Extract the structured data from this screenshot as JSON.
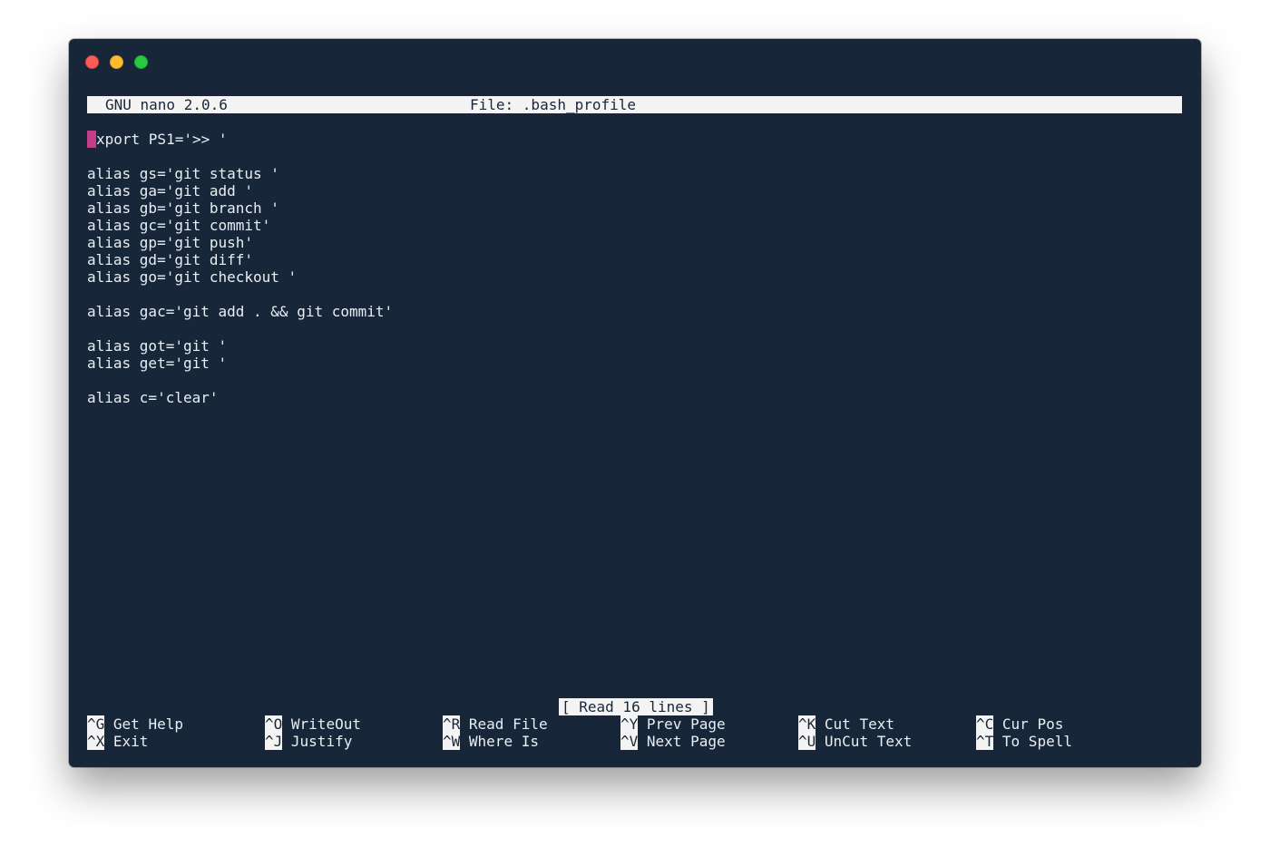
{
  "window": {
    "title_left": "GNU nano 2.0.6",
    "title_right": "File: .bash_profile"
  },
  "editor": {
    "cursor_char": "e",
    "lines": [
      "xport PS1='>> '",
      "",
      "alias gs='git status '",
      "alias ga='git add '",
      "alias gb='git branch '",
      "alias gc='git commit'",
      "alias gp='git push'",
      "alias gd='git diff'",
      "alias go='git checkout '",
      "",
      "alias gac='git add . && git commit'",
      "",
      "alias got='git '",
      "alias get='git '",
      "",
      "alias c='clear'"
    ]
  },
  "status": "[ Read 16 lines ]",
  "shortcuts": {
    "row1": [
      {
        "key": "^G",
        "label": "Get Help"
      },
      {
        "key": "^O",
        "label": "WriteOut"
      },
      {
        "key": "^R",
        "label": "Read File"
      },
      {
        "key": "^Y",
        "label": "Prev Page"
      },
      {
        "key": "^K",
        "label": "Cut Text"
      },
      {
        "key": "^C",
        "label": "Cur Pos"
      }
    ],
    "row2": [
      {
        "key": "^X",
        "label": "Exit"
      },
      {
        "key": "^J",
        "label": "Justify"
      },
      {
        "key": "^W",
        "label": "Where Is"
      },
      {
        "key": "^V",
        "label": "Next Page"
      },
      {
        "key": "^U",
        "label": "UnCut Text"
      },
      {
        "key": "^T",
        "label": "To Spell"
      }
    ]
  },
  "colors": {
    "background": "#18263a",
    "foreground": "#e9eef3",
    "inverse_bg": "#f4f4f4",
    "cursor": "#c23d8a"
  }
}
